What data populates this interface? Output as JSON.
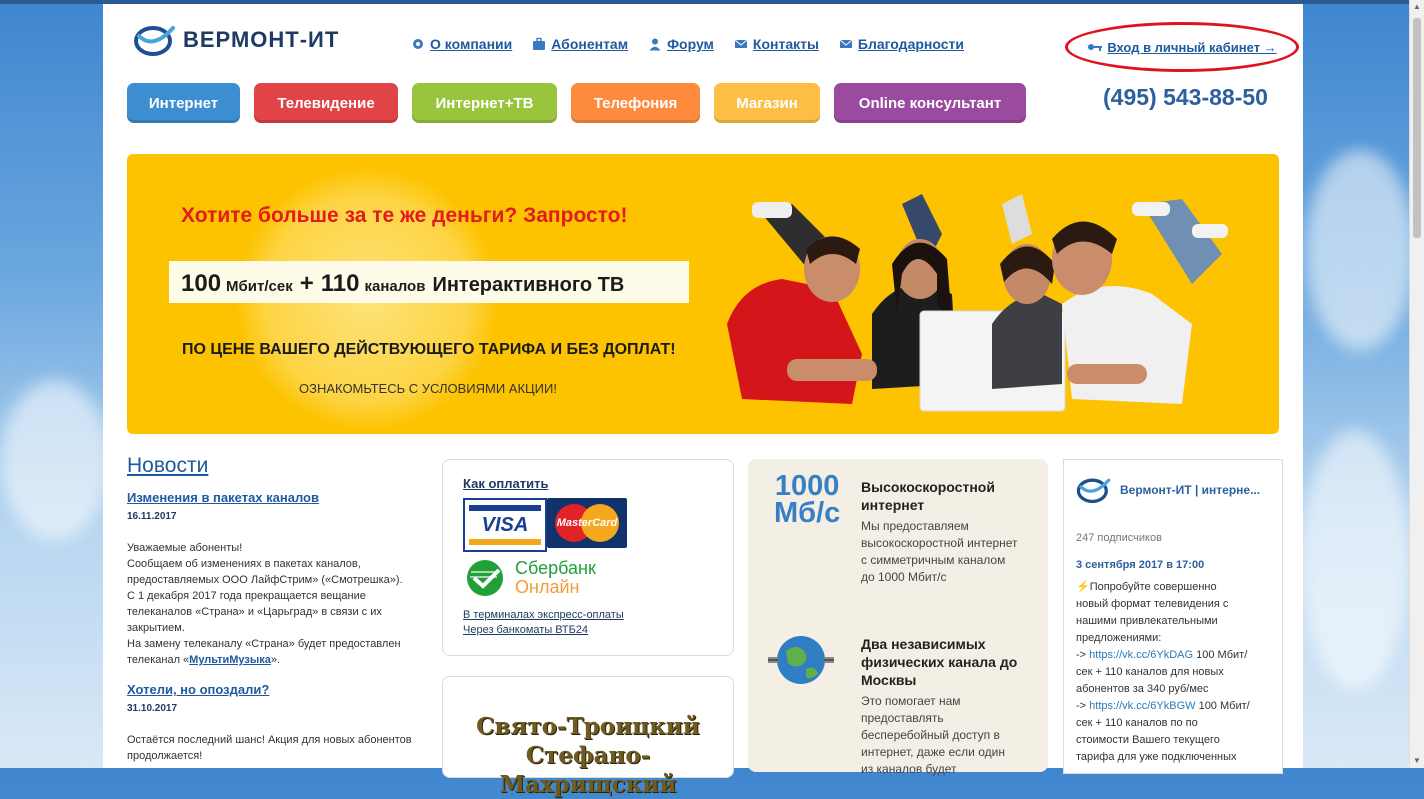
{
  "logo": {
    "text": "ВЕРМОНТ-ИТ",
    "icon": "vermont-logo-icon"
  },
  "top_nav": [
    {
      "label": "О компании",
      "icon": "gear-icon"
    },
    {
      "label": "Абонентам",
      "icon": "briefcase-icon"
    },
    {
      "label": "Форум",
      "icon": "user-icon"
    },
    {
      "label": "Контакты",
      "icon": "mail-icon"
    },
    {
      "label": "Благодарности",
      "icon": "mail-icon"
    }
  ],
  "login": {
    "label": "Вход в личный кабинет →",
    "icon": "key-icon"
  },
  "phone": "(495) 543-88-50",
  "categories": [
    {
      "label": "Интернет",
      "color": "#3d8ed0"
    },
    {
      "label": "Телевидение",
      "color": "#e04446"
    },
    {
      "label": "Интернет+ТВ",
      "color": "#99c43d"
    },
    {
      "label": "Телефония",
      "color": "#fc8b3d"
    },
    {
      "label": "Магазин",
      "color": "#fdbe45"
    },
    {
      "label": "Online консультант",
      "color": "#9a4b9f"
    }
  ],
  "banner": {
    "headline": "Хотите больше за те же деньги? Запросто!",
    "speed_num": "100",
    "speed_unit": "Мбит/сек",
    "plus": "+",
    "channels_num": "110",
    "channels_word": "каналов",
    "tv_word": "Интерактивного ТВ",
    "sub": "ПО ЦЕНЕ ВАШЕГО ДЕЙСТВУЮЩЕГО ТАРИФА И БЕЗ ДОПЛАТ!",
    "link": "ОЗНАКОМЬТЕСЬ С УСЛОВИЯМИ АКЦИИ!"
  },
  "news": {
    "heading": "Новости",
    "items": [
      {
        "title": "Изменения в пакетах каналов",
        "date": "16.11.2017",
        "body_lines": [
          "Уважаемые абоненты!",
          "Сообщаем об изменениях в пакетах каналов,",
          "предоставляемых ООО ЛайфСтрим» («Смотрешка»).",
          "С 1 декабря 2017 года прекращается вещание",
          "телеканалов «Страна» и «Царьград» в связи с их",
          "закрытием.",
          "На замену телеканалу «Страна» будет предоставлен"
        ],
        "last_line_prefix": "телеканал «",
        "last_line_link": "МультиМузыка",
        "last_line_suffix": "»."
      },
      {
        "title": "Хотели, но опоздали?",
        "date": "31.10.2017",
        "body_lines": [
          "Остаётся последний шанс! Акция для новых абонентов",
          "продолжается!"
        ]
      }
    ]
  },
  "payment": {
    "heading": "Как оплатить",
    "visa": "VISA",
    "mastercard": "MasterCard",
    "sber_line1": "Сбербанк",
    "sber_line2": "Онлайн",
    "links": [
      "В терминалах экспресс-оплаты",
      "Через банкоматы ВТБ24"
    ]
  },
  "church": {
    "line1": "Свято-Троицкий",
    "line2": "Стефано-Махрищский"
  },
  "features": [
    {
      "badge_num": "1000",
      "badge_unit": "Мб/с",
      "title_lines": [
        "Высокоскоростной",
        "интернет"
      ],
      "text_lines": [
        "Мы предоставляем",
        "высокоскоростной интернет",
        "с симметричным каналом",
        "до 1000 Мбит/с"
      ]
    },
    {
      "icon": "globe-network-icon",
      "title_lines": [
        "Два независимых",
        "физических канала до",
        "Москвы"
      ],
      "text_lines": [
        "Это помогает нам",
        "предоставлять",
        "бесперебойный доступ в",
        "интернет, даже если один",
        "из каналов будет"
      ]
    }
  ],
  "vk_widget": {
    "name": "Вермонт-ИТ | интерне...",
    "subscribers": "247 подписчиков",
    "post_date": "3 сентября 2017 в 17:00",
    "post_lines": [
      {
        "text": "⚡Попробуйте совершенно"
      },
      {
        "text": "новый формат телевидения с"
      },
      {
        "text": "нашими привлекательными"
      },
      {
        "text": "предложениями:"
      },
      {
        "prefix": "-> ",
        "link": "https://vk.cc/6YkDAG",
        "text": " 100 Мбит/"
      },
      {
        "text": "сек + 110 каналов для новых"
      },
      {
        "text": "абонентов за 340 руб/мес"
      },
      {
        "prefix": "-> ",
        "link": "https://vk.cc/6YkBGW",
        "text": " 100 Мбит/"
      },
      {
        "text": "сек + 110 каналов по по"
      },
      {
        "text": "стоимости Вашего текущего"
      },
      {
        "text": "тарифа для уже подключенных"
      }
    ]
  }
}
